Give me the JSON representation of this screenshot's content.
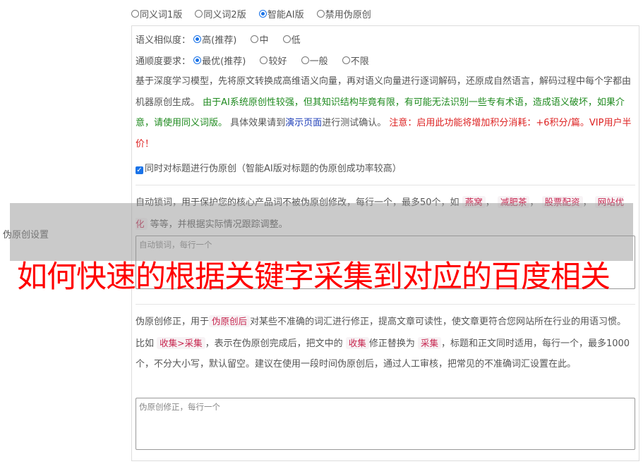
{
  "mode_options": [
    {
      "label": "同义词1版",
      "checked": false
    },
    {
      "label": "同义词2版",
      "checked": false
    },
    {
      "label": "智能AI版",
      "checked": true
    },
    {
      "label": "禁用伪原创",
      "checked": false
    }
  ],
  "settings_label": "伪原创设置",
  "similarity": {
    "label": "语义相似度：",
    "options": [
      {
        "label": "高(推荐)",
        "checked": true
      },
      {
        "label": "中",
        "checked": false
      },
      {
        "label": "低",
        "checked": false
      }
    ]
  },
  "fluency": {
    "label": "通顺度要求：",
    "options": [
      {
        "label": "最优(推荐)",
        "checked": true
      },
      {
        "label": "较好",
        "checked": false
      },
      {
        "label": "一般",
        "checked": false
      },
      {
        "label": "不限",
        "checked": false
      }
    ]
  },
  "ai_desc": {
    "p1": "基于深度学习模型，先将原文转换成高维语义向量，再对语义向量进行逐词解码，还原成自然语言，解码过程中每个字都由机器原创生成。",
    "p2_green": "由于AI系统原创性较强，但其知识结构毕竟有限，有可能无法识别一些专有术语，造成语义破坏，如果介意，请使用同义词版。",
    "p3a": "具体效果请到",
    "p3_link": "演示页面",
    "p3b": "进行测试确认。",
    "p4_red": "注意：启用此功能将增加积分消耗：+6积分/篇。VIP用户半价！"
  },
  "title_checkbox": "同时对标题进行伪原创（智能AI版对标题的伪原创成功率较高）",
  "lock": {
    "text_a": "自动锁词，用于保护您的核心产品词不被伪原创修改，每行一个，最多50个，如",
    "tags": [
      "燕窝",
      "减肥茶",
      "股票配资",
      "网站优化"
    ],
    "text_b": "等等，并根据实际情况跟踪调整。",
    "placeholder": "自动锁词，每行一个"
  },
  "headline": "如何快速的根据关键字采集到对应的百度相关",
  "correction": {
    "t1": "伪原创修正，用于",
    "tag1": "伪原创后",
    "t2": "对某些不准确的词汇进行修正，提高文章可读性，使文章更符合您网站所在行业的用语习惯。比如",
    "tag2": "收集>采集",
    "t3": "，表示在伪原创完成后，把文中的",
    "tag3": "收集",
    "t4": "修正替换为",
    "tag4": "采集",
    "t5": "，标题和正文同时适用，每行一个，最多1000个，不分大小写，默认留空。建议在使用一段时间伪原创后，通过人工审核，把常见的不准确词汇设置在此。",
    "placeholder": "伪原创修正，每行一个"
  }
}
